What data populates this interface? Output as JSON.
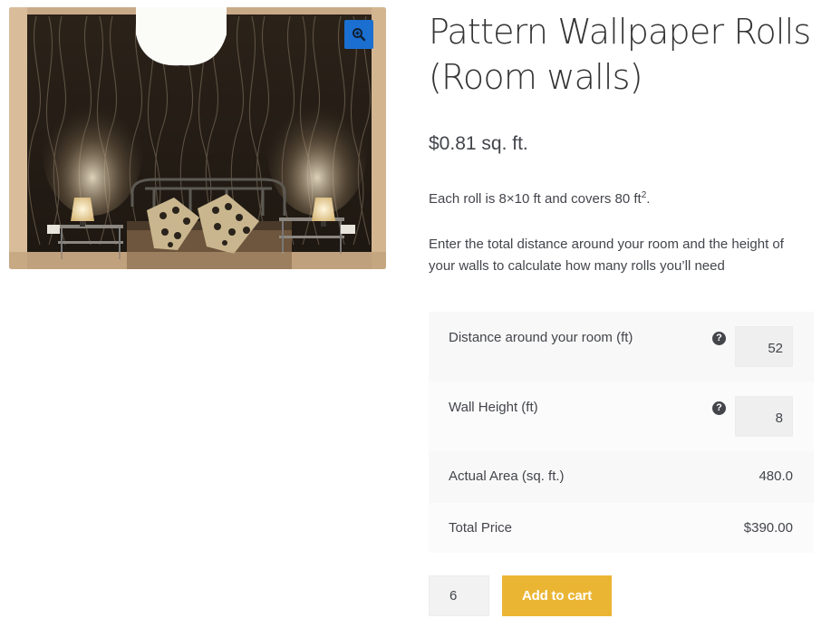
{
  "product": {
    "title_line1": "Pattern Wallpaper Rolls",
    "title_line2": "(Room walls)",
    "price": "$0.81 sq. ft.",
    "description_main": "Each roll is 8×10 ft and covers 80 ft",
    "description_sup": "2",
    "description_end": ".",
    "instructions": "Enter the total distance around your room and the height of your walls to calculate how many rolls you’ll need",
    "image_icon": "zoom-in-icon"
  },
  "calculator": {
    "distance_label": "Distance around your room (ft)",
    "distance_value": "52",
    "height_label": "Wall Height (ft)",
    "height_value": "8",
    "help_icon": "?",
    "area_label": "Actual Area (sq. ft.)",
    "area_value": "480.0",
    "total_label": "Total Price",
    "total_value": "$390.00"
  },
  "cart": {
    "quantity": "6",
    "add_to_cart_label": "Add to cart"
  },
  "colors": {
    "accent": "#ebb534",
    "zoom_button": "#1b6fd1",
    "text": "#43454b"
  }
}
